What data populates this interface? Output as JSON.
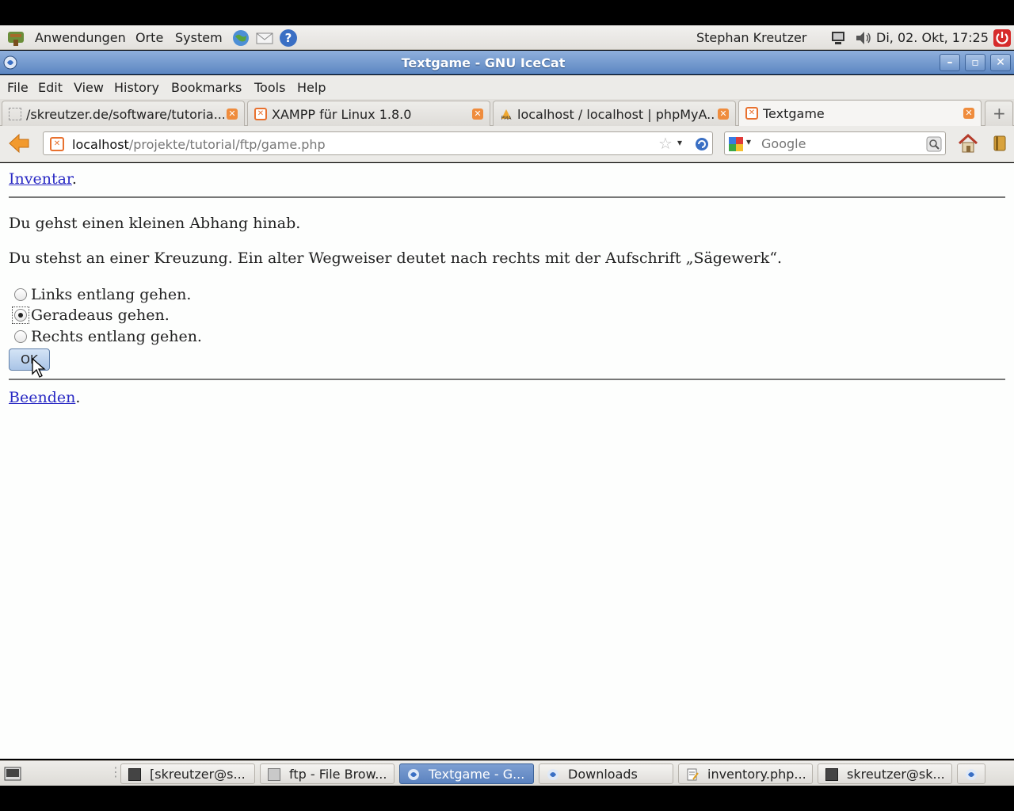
{
  "panel": {
    "menu_apps": "Anwendungen",
    "menu_places": "Orte",
    "menu_system": "System",
    "user": "Stephan Kreutzer",
    "clock": "Di, 02. Okt, 17:25"
  },
  "window": {
    "title": "Textgame - GNU IceCat"
  },
  "menubar": {
    "file": "File",
    "edit": "Edit",
    "view": "View",
    "history": "History",
    "bookmarks": "Bookmarks",
    "tools": "Tools",
    "help": "Help"
  },
  "tabs": [
    {
      "label": "/skreutzer.de/software/tutoria..."
    },
    {
      "label": "XAMPP für Linux 1.8.0"
    },
    {
      "label": "localhost / localhost | phpMyA..."
    },
    {
      "label": "Textgame"
    }
  ],
  "navbar": {
    "url_host": "localhost",
    "url_path": "/projekte/tutorial/ftp/game.php",
    "search_placeholder": "Google"
  },
  "page": {
    "inventory_link": "Inventar",
    "narrative_1": "Du gehst einen kleinen Abhang hinab.",
    "narrative_2": "Du stehst an einer Kreuzung. Ein alter Wegweiser deutet nach rechts mit der Aufschrift „Sägewerk“.",
    "options": [
      {
        "label": "Links entlang gehen.",
        "checked": false
      },
      {
        "label": "Geradeaus gehen.",
        "checked": true
      },
      {
        "label": "Rechts entlang gehen.",
        "checked": false
      }
    ],
    "ok_label": "OK",
    "quit_link": "Beenden"
  },
  "taskbar": [
    {
      "label": "[skreutzer@s..."
    },
    {
      "label": "ftp - File Brow..."
    },
    {
      "label": "Textgame - G..."
    },
    {
      "label": "Downloads"
    },
    {
      "label": "inventory.php..."
    },
    {
      "label": "skreutzer@sk..."
    }
  ]
}
